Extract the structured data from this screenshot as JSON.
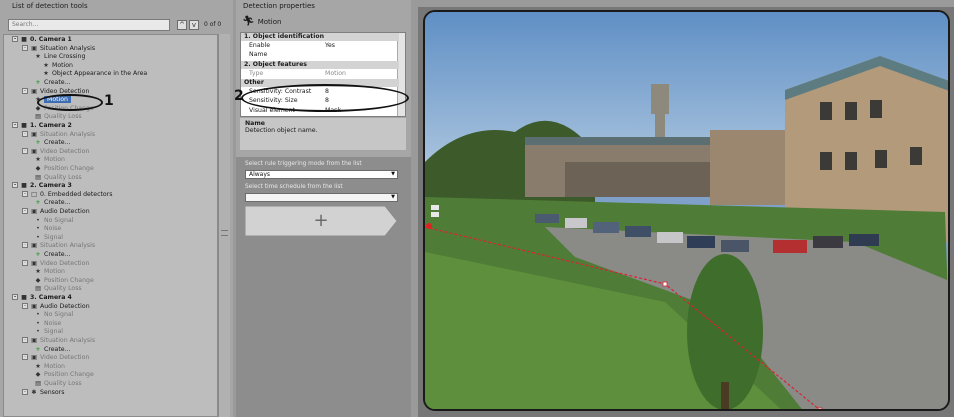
{
  "left_panel": {
    "header": "List of detection tools",
    "search_placeholder": "Search...",
    "counter": "0 of 0",
    "tree": [
      {
        "label": "0. Camera 1"
      },
      {
        "label": "Situation Analysis"
      },
      {
        "label": "Line Crossing"
      },
      {
        "label": "Motion"
      },
      {
        "label": "Object Appearance in the Area"
      },
      {
        "label": "Create..."
      },
      {
        "label": "Video Detection"
      },
      {
        "label": "Motion"
      },
      {
        "label": "Position Change"
      },
      {
        "label": "Quality Loss"
      },
      {
        "label": "1. Camera 2"
      },
      {
        "label": "Situation Analysis"
      },
      {
        "label": "Create..."
      },
      {
        "label": "Video Detection"
      },
      {
        "label": "Motion"
      },
      {
        "label": "Position Change"
      },
      {
        "label": "Quality Loss"
      },
      {
        "label": "2. Camera 3"
      },
      {
        "label": "0. Embedded detectors"
      },
      {
        "label": "Create..."
      },
      {
        "label": "Audio Detection"
      },
      {
        "label": "No Signal"
      },
      {
        "label": "Noise"
      },
      {
        "label": "Signal"
      },
      {
        "label": "Situation Analysis"
      },
      {
        "label": "Create..."
      },
      {
        "label": "Video Detection"
      },
      {
        "label": "Motion"
      },
      {
        "label": "Position Change"
      },
      {
        "label": "Quality Loss"
      },
      {
        "label": "3. Camera 4"
      },
      {
        "label": "Audio Detection"
      },
      {
        "label": "No Signal"
      },
      {
        "label": "Noise"
      },
      {
        "label": "Signal"
      },
      {
        "label": "Situation Analysis"
      },
      {
        "label": "Create..."
      },
      {
        "label": "Video Detection"
      },
      {
        "label": "Motion"
      },
      {
        "label": "Position Change"
      },
      {
        "label": "Quality Loss"
      },
      {
        "label": "Sensors"
      }
    ]
  },
  "properties": {
    "header": "Detection properties",
    "title": "Motion",
    "rows": [
      {
        "key": "1. Object identification",
        "value": ""
      },
      {
        "key": "Enable",
        "value": "Yes"
      },
      {
        "key": "Name",
        "value": ""
      },
      {
        "key": "2. Object features",
        "value": ""
      },
      {
        "key": "Type",
        "value": "Motion"
      },
      {
        "key": "Other",
        "value": ""
      },
      {
        "key": "Sensitivity: Contrast",
        "value": "8"
      },
      {
        "key": "Sensitivity: Size",
        "value": "8"
      },
      {
        "key": "Visual element",
        "value": "Mask"
      }
    ],
    "desc_title": "Name",
    "desc_text": "Detection object name.",
    "rule_label": "Select rule triggering mode from the list",
    "rule_value": "Always",
    "schedule_label": "Select time schedule from the list",
    "schedule_value": "",
    "add_label": "+"
  },
  "annotations": {
    "one": "1",
    "two": "2"
  },
  "icons": [
    "motion-icon",
    "situation-analysis-icon",
    "video-detection-icon",
    "audio-detection-icon",
    "camera-icon",
    "create-icon",
    "sensors-icon",
    "plus-icon"
  ]
}
